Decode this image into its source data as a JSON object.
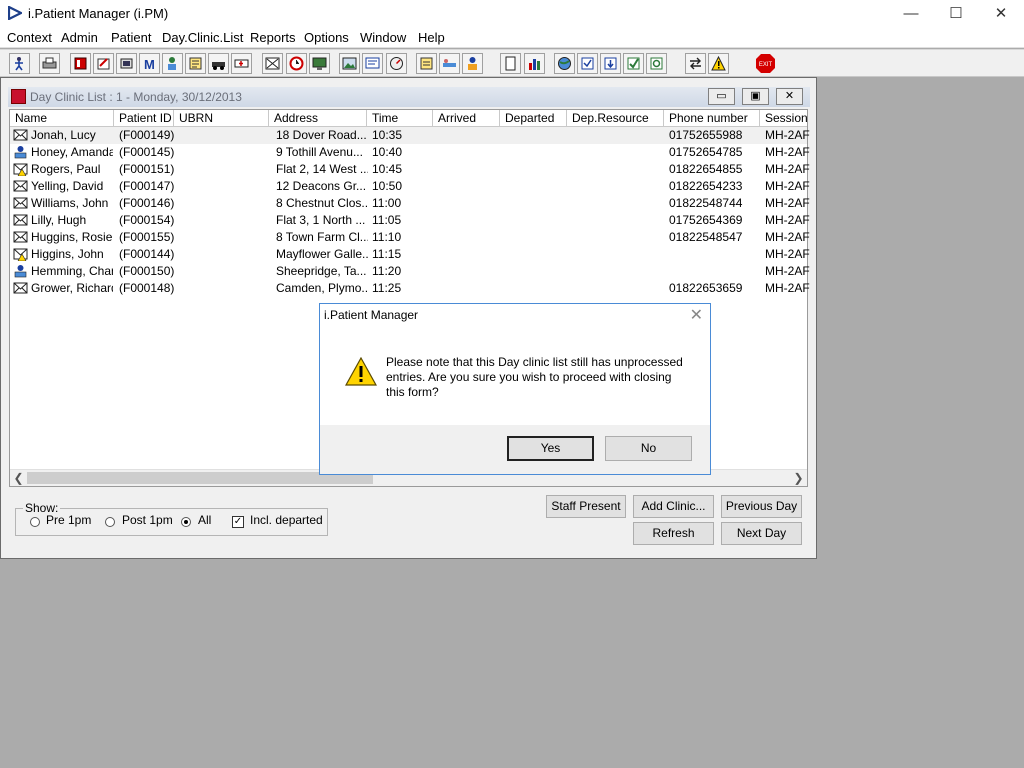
{
  "app": {
    "title": "i.Patient Manager (i.PM)"
  },
  "window_controls": {
    "minimize": "—",
    "maximize": "☐",
    "close": "✕"
  },
  "menu": [
    {
      "label": "Context"
    },
    {
      "label": "Admin"
    },
    {
      "label": "Patient"
    },
    {
      "label": "Day.Clinic.List"
    },
    {
      "label": "Reports"
    },
    {
      "label": "Options"
    },
    {
      "label": "Window"
    },
    {
      "label": "Help"
    }
  ],
  "toolbar_icons": [
    "person-walk-icon",
    "printer-icon",
    "book-red-icon",
    "notepad-icon",
    "scanner-icon",
    "letter-m-icon",
    "doctor-icon",
    "notes-icon",
    "car-icon",
    "ambulance-icon",
    "patient-list-icon",
    "clock-icon",
    "monitor-icon",
    "photo-icon",
    "message-icon",
    "gauge-icon",
    "pad-icon",
    "bed-icon",
    "worker-icon",
    "document-icon",
    "bar-chart-icon",
    "globe-icon",
    "clipboard-check-icon",
    "clipboard-down-icon",
    "clipboard-green-icon",
    "clipboard-refresh-icon",
    "transfer-icon",
    "warning-icon",
    "exit-icon"
  ],
  "exit_label": "EXIT",
  "child_window": {
    "title": "Day Clinic List : 1 - Monday, 30/12/2013",
    "controls": {
      "minimize": "▭",
      "restore": "▣",
      "close": "✕"
    }
  },
  "columns": [
    "Name",
    "Patient ID",
    "UBRN",
    "Address",
    "Time",
    "Arrived",
    "Departed",
    "Dep.Resource",
    "Phone number",
    "Session Code"
  ],
  "rows": [
    {
      "name": "Jonah, Lucy",
      "pid": "(F000149)",
      "ubrn": "",
      "address": "18 Dover Road...",
      "time": "10:35",
      "arrived": "",
      "departed": "",
      "dep_resource": "",
      "phone": "01752655988",
      "session": "MH-2AF",
      "icon": "envelope-icon"
    },
    {
      "name": "Honey, Amanda",
      "pid": "(F000145)",
      "ubrn": "",
      "address": "9 Tothill Avenu...",
      "time": "10:40",
      "arrived": "",
      "departed": "",
      "dep_resource": "",
      "phone": "01752654785",
      "session": "MH-2AF",
      "icon": "patient-icon"
    },
    {
      "name": "Rogers, Paul",
      "pid": "(F000151)",
      "ubrn": "",
      "address": "Flat 2, 14 West ...",
      "time": "10:45",
      "arrived": "",
      "departed": "",
      "dep_resource": "",
      "phone": "01822654855",
      "session": "MH-2AF",
      "icon": "envelope-warning-icon"
    },
    {
      "name": "Yelling, David",
      "pid": "(F000147)",
      "ubrn": "",
      "address": "12 Deacons Gr...",
      "time": "10:50",
      "arrived": "",
      "departed": "",
      "dep_resource": "",
      "phone": "01822654233",
      "session": "MH-2AF",
      "icon": "envelope-icon"
    },
    {
      "name": "Williams, John",
      "pid": "(F000146)",
      "ubrn": "",
      "address": "8 Chestnut Clos...",
      "time": "11:00",
      "arrived": "",
      "departed": "",
      "dep_resource": "",
      "phone": "01822548744",
      "session": "MH-2AF",
      "icon": "envelope-icon"
    },
    {
      "name": "Lilly, Hugh",
      "pid": "(F000154)",
      "ubrn": "",
      "address": "Flat 3, 1 North ...",
      "time": "11:05",
      "arrived": "",
      "departed": "",
      "dep_resource": "",
      "phone": "01752654369",
      "session": "MH-2AF",
      "icon": "envelope-icon"
    },
    {
      "name": "Huggins, Rosie",
      "pid": "(F000155)",
      "ubrn": "",
      "address": "8 Town Farm Cl...",
      "time": "11:10",
      "arrived": "",
      "departed": "",
      "dep_resource": "",
      "phone": "01822548547",
      "session": "MH-2AF",
      "icon": "envelope-icon"
    },
    {
      "name": "Higgins, John",
      "pid": "(F000144)",
      "ubrn": "",
      "address": "Mayflower Galle...",
      "time": "11:15",
      "arrived": "",
      "departed": "",
      "dep_resource": "",
      "phone": "",
      "session": "MH-2AF",
      "icon": "envelope-warning-icon"
    },
    {
      "name": "Hemming, Char...",
      "pid": "(F000150)",
      "ubrn": "",
      "address": "Sheepridge, Ta...",
      "time": "11:20",
      "arrived": "",
      "departed": "",
      "dep_resource": "",
      "phone": "",
      "session": "MH-2AF",
      "icon": "patient-icon"
    },
    {
      "name": "Grower, Richard",
      "pid": "(F000148)",
      "ubrn": "",
      "address": "Camden, Plymo...",
      "time": "11:25",
      "arrived": "",
      "departed": "",
      "dep_resource": "",
      "phone": "01822653659",
      "session": "MH-2AF",
      "icon": "envelope-icon"
    }
  ],
  "show": {
    "label": "Show:",
    "options": [
      {
        "label": "Pre 1pm",
        "checked": false
      },
      {
        "label": "Post 1pm",
        "checked": false
      },
      {
        "label": "All",
        "checked": true
      }
    ],
    "incl_departed": {
      "label": "Incl. departed",
      "checked": true
    }
  },
  "buttons": {
    "staff_present": "Staff Present",
    "add_clinic": "Add Clinic...",
    "previous_day": "Previous Day",
    "refresh": "Refresh",
    "next_day": "Next Day"
  },
  "dialog": {
    "title": "i.Patient Manager",
    "message": "Please note that this Day clinic list still has unprocessed entries. Are you sure you wish to proceed with closing this form?",
    "yes": "Yes",
    "no": "No",
    "close": "✕"
  },
  "colors": {
    "accent": "#4a8bd6",
    "selected_row": "#f0f0f0",
    "exit_red": "#d40000"
  }
}
